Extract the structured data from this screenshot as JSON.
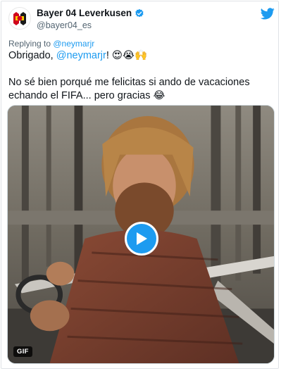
{
  "tweet": {
    "display_name": "Bayer 04 Leverkusen",
    "handle": "@bayer04_es",
    "replying_prefix": "Replying to ",
    "replying_to": "@neymarjr",
    "line1_prefix": "Obrigado, ",
    "line1_mention": "@neymarjr",
    "line1_suffix": "! 😍😭🙌",
    "line2": "No sé bien porqué me felicitas si ando de vacaciones echando el FIFA... pero gracias 😂"
  },
  "media": {
    "badge": "GIF"
  },
  "icons": {
    "verified": "verified-badge-icon",
    "platform": "twitter-bird-icon",
    "play": "play-icon"
  },
  "colors": {
    "accent": "#1d9bf0",
    "text": "#0f1419",
    "secondary": "#536471"
  }
}
